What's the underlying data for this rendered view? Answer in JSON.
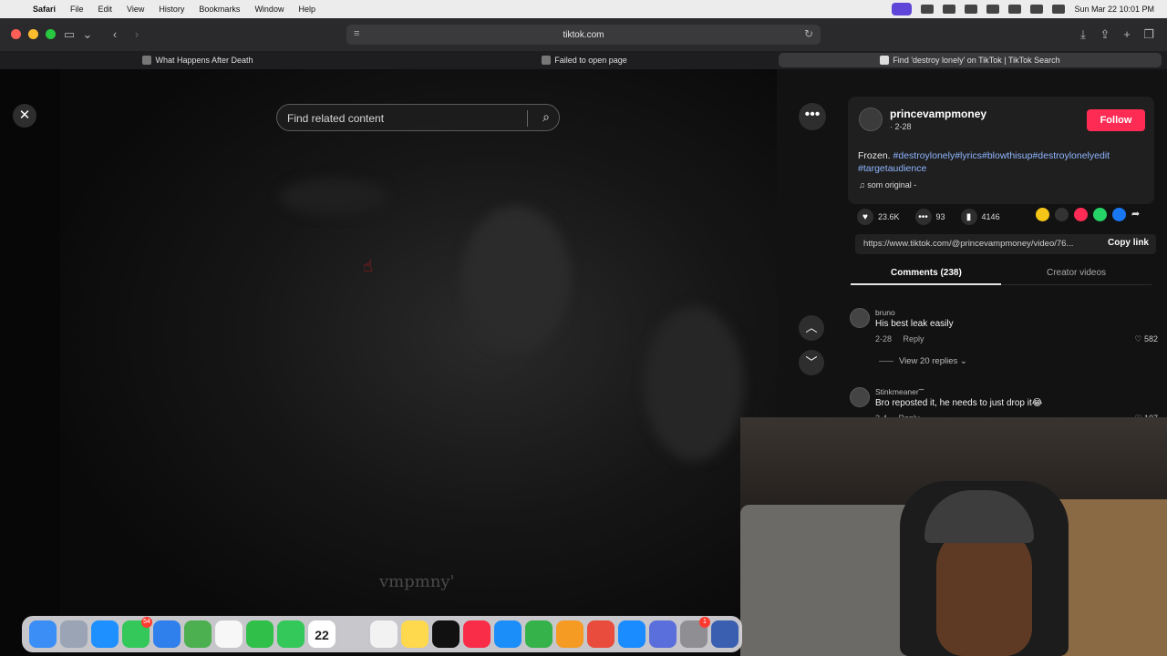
{
  "menubar": {
    "apple_icon": "apple-logo-icon",
    "app": "Safari",
    "items": [
      "File",
      "Edit",
      "View",
      "History",
      "Bookmarks",
      "Window",
      "Help"
    ],
    "clock": "Sun Mar 22  10:01 PM"
  },
  "browser": {
    "url": "tiktok.com",
    "tabs": [
      {
        "label": "What Happens After Death"
      },
      {
        "label": "Failed to open page"
      },
      {
        "label": "Find 'destroy lonely' on TikTok | TikTok Search"
      }
    ]
  },
  "player": {
    "search_placeholder": "Find related content",
    "watermark": "vmpmny'"
  },
  "post": {
    "username": "princevampmoney",
    "date": "· 2-28",
    "follow_label": "Follow",
    "caption_text": "Frozen. ",
    "caption_tags": "#destroylonely#lyrics#blowthisup#destroylonelyedit #targetaudience",
    "sound": "♫  som original -",
    "likes": "23.6K",
    "comments": "93",
    "saves": "4146",
    "link": "https://www.tiktok.com/@princevampmoney/video/76...",
    "copy_label": "Copy link"
  },
  "tabs": {
    "comments": "Comments (238)",
    "creator": "Creator videos"
  },
  "comments": [
    {
      "name": "bruno",
      "text": "His best leak easily",
      "date": "2-28",
      "reply": "Reply",
      "likes": "582"
    },
    {
      "name": "Stinkmeaner˜˜",
      "text": "Bro reposted it, he needs to just drop it😂",
      "date": "3-4",
      "reply": "Reply",
      "likes": "107"
    }
  ],
  "view_replies": "View 20 replies",
  "dock": {
    "calendar_day": "22",
    "messages_badge": "54",
    "settings_badge": "1"
  }
}
